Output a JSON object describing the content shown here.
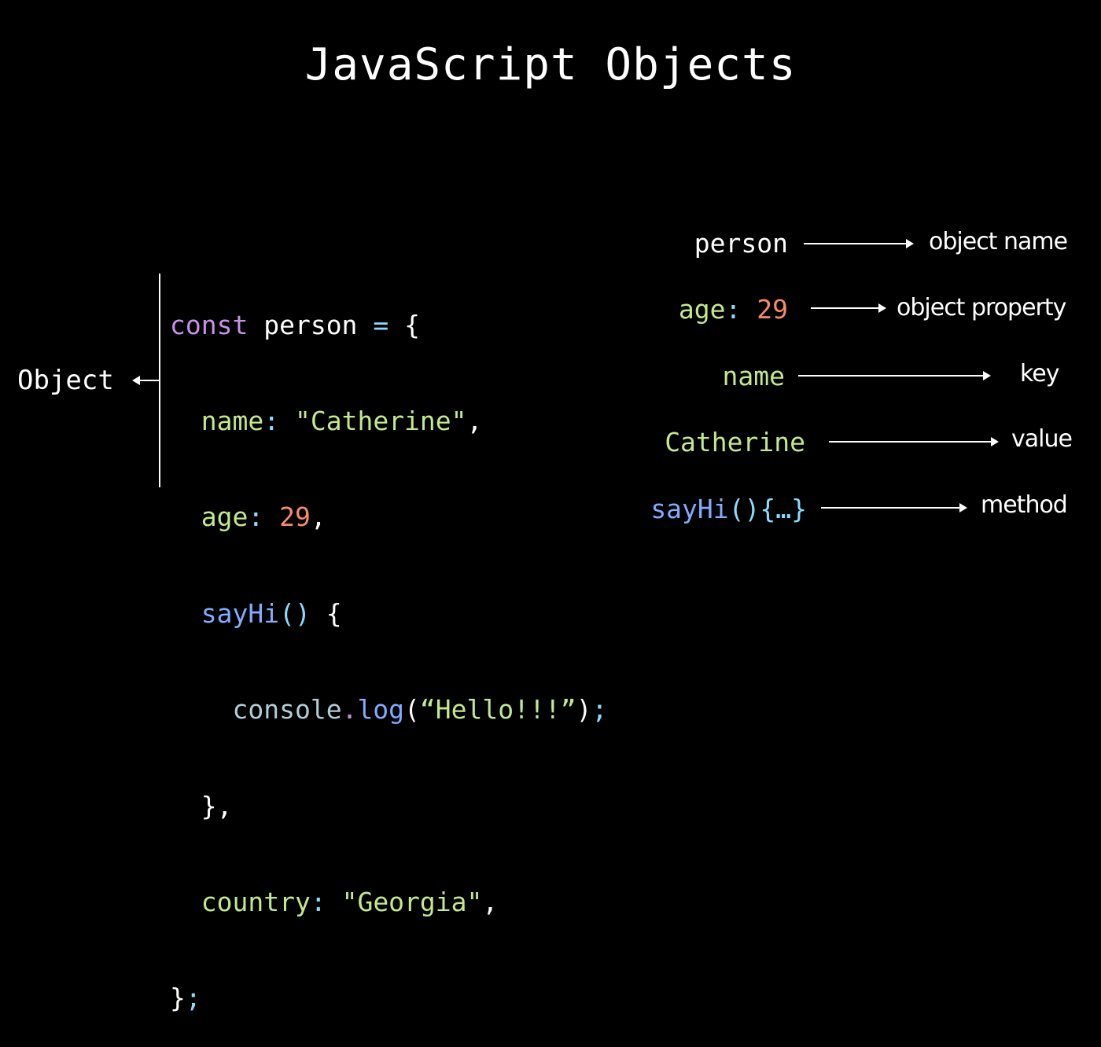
{
  "title": "JavaScript Objects",
  "code": {
    "line1": {
      "kw": "const",
      "name": "person",
      "op": "=",
      "brace": "{"
    },
    "line2": {
      "key": "name",
      "colon": ":",
      "value": "\"Catherine\"",
      "comma": ","
    },
    "line3": {
      "key": "age",
      "colon": ":",
      "value": "29",
      "comma": ","
    },
    "line4": {
      "fn": "sayHi",
      "parens": "()",
      "brace": "{"
    },
    "line5": {
      "obj": "console",
      "dot": ".",
      "method": "log",
      "open": "(",
      "arg": "“Hello!!!”",
      "close": ")",
      "semi": ";"
    },
    "line6": {
      "text": "},"
    },
    "line7": {
      "key": "country",
      "colon": ":",
      "value": "\"Georgia\"",
      "comma": ","
    },
    "line8": {
      "brace": "}",
      "semi": ";"
    }
  },
  "object_label": "Object",
  "legend": [
    {
      "term": "person",
      "term_color": "#ffffff",
      "description": "object name"
    },
    {
      "term_key": "age",
      "term_colon": ":",
      "term_value": "29",
      "description": "object property"
    },
    {
      "term": "name",
      "term_color": "#c3e88d",
      "description": "key"
    },
    {
      "term": "Catherine",
      "term_color": "#c3e88d",
      "description": "value"
    },
    {
      "term_fn": "sayHi",
      "term_parens": "(){…}",
      "description": "method"
    }
  ],
  "colors": {
    "background": "#000000",
    "keyword": "#c792ea",
    "operator": "#89ddff",
    "string_key": "#c3e88d",
    "number": "#f78c6c",
    "function": "#82aaff",
    "object": "#b2ccd6",
    "text": "#ffffff"
  }
}
